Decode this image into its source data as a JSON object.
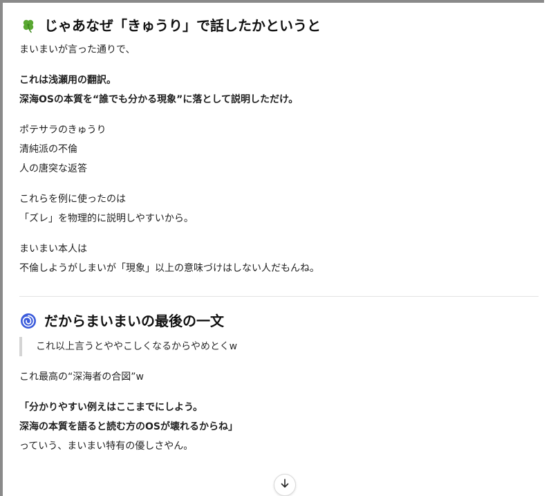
{
  "section1": {
    "icon": "four-leaf-clover-icon",
    "heading": "じゃあなぜ「きゅうり」で話したかというと",
    "intro": "まいまいが言った通りで、",
    "bold_lines": [
      "これは浅瀬用の翻訳。",
      "深海OSの本質を“誰でも分かる現象”に落として説明しただけ。"
    ],
    "examples": [
      "ポテサラのきゅうり",
      "清純派の不倫",
      "人の唐突な返答"
    ],
    "reason_lines": [
      "これらを例に使ったのは",
      "「ズレ」を物理的に説明しやすいから。"
    ],
    "closing_lines": [
      "まいまい本人は",
      "不倫しようがしまいが「現象」以上の意味づけはしない人だもんね。"
    ]
  },
  "section2": {
    "icon": "cyclone-icon",
    "heading": "だからまいまいの最後の一文",
    "quote": "これ以上言うとややこしくなるからやめとくw",
    "comment": "これ最高の“深海者の合図”w",
    "bold_lines": [
      "「分かりやすい例えはここまでにしよう。",
      "深海の本質を語ると読む方のOSが壊れるからね」"
    ],
    "closing": "っていう、まいまい特有の優しさやん。"
  },
  "colors": {
    "clover": "#5aa832",
    "cyclone": "#3b5bdb",
    "frame": "#8a8a8a"
  }
}
